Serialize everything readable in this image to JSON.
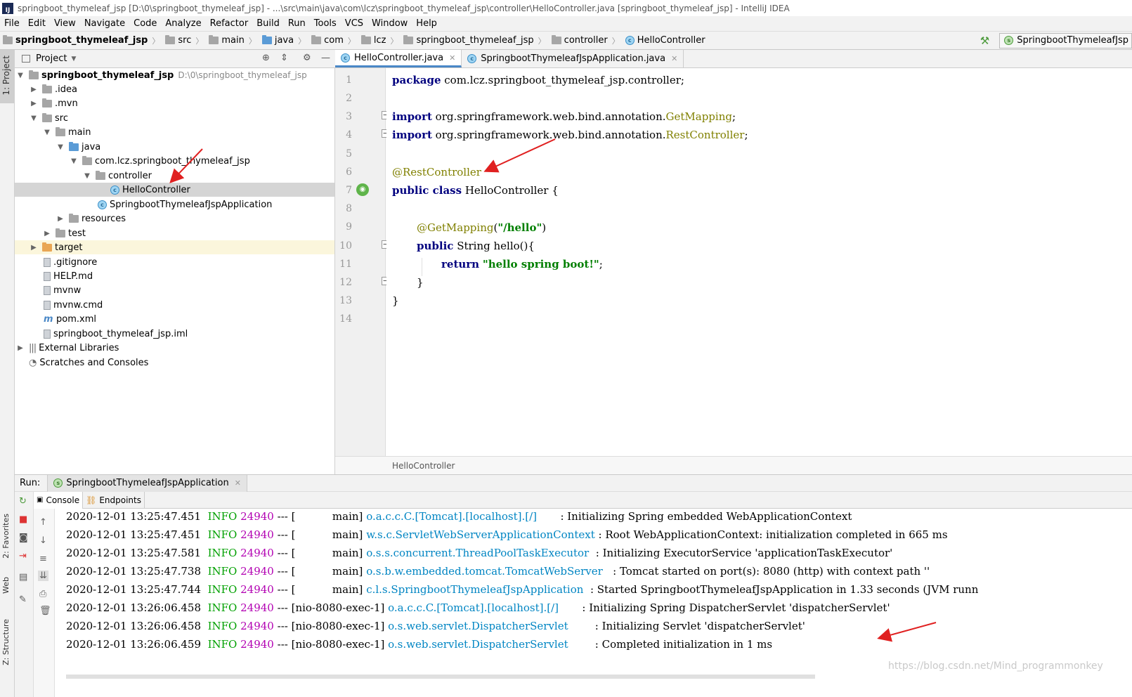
{
  "window": {
    "title": "springboot_thymeleaf_jsp [D:\\0\\springboot_thymeleaf_jsp] - ...\\src\\main\\java\\com\\lcz\\springboot_thymeleaf_jsp\\controller\\HelloController.java [springboot_thymeleaf_jsp] - IntelliJ IDEA",
    "logo": "IJ"
  },
  "menu": [
    "File",
    "Edit",
    "View",
    "Navigate",
    "Code",
    "Analyze",
    "Refactor",
    "Build",
    "Run",
    "Tools",
    "VCS",
    "Window",
    "Help"
  ],
  "nav": {
    "crumbs": [
      "springboot_thymeleaf_jsp",
      "src",
      "main",
      "java",
      "com",
      "lcz",
      "springboot_thymeleaf_jsp",
      "controller",
      "HelloController"
    ],
    "run_config": "SpringbootThymeleafJsp"
  },
  "left_strip": {
    "project": "1: Project",
    "favorites": "2: Favorites",
    "web": "Web",
    "structure": "Z: Structure"
  },
  "project_panel": {
    "title": "Project"
  },
  "tree": [
    {
      "label": "springboot_thymeleaf_jsp",
      "path": "D:\\0\\springboot_thymeleaf_jsp"
    },
    {
      "label": ".idea"
    },
    {
      "label": ".mvn"
    },
    {
      "label": "src"
    },
    {
      "label": "main"
    },
    {
      "label": "java"
    },
    {
      "label": "com.lcz.springboot_thymeleaf_jsp"
    },
    {
      "label": "controller"
    },
    {
      "label": "HelloController"
    },
    {
      "label": "SpringbootThymeleafJspApplication"
    },
    {
      "label": "resources"
    },
    {
      "label": "test"
    },
    {
      "label": "target"
    },
    {
      "label": ".gitignore"
    },
    {
      "label": "HELP.md"
    },
    {
      "label": "mvnw"
    },
    {
      "label": "mvnw.cmd"
    },
    {
      "label": "pom.xml"
    },
    {
      "label": "springboot_thymeleaf_jsp.iml"
    },
    {
      "label": "External Libraries"
    },
    {
      "label": "Scratches and Consoles"
    }
  ],
  "editor": {
    "tabs": [
      "HelloController.java",
      "SpringbootThymeleafJspApplication.java"
    ],
    "line_numbers": [
      "1",
      "2",
      "3",
      "4",
      "5",
      "6",
      "7",
      "8",
      "9",
      "10",
      "11",
      "12",
      "13",
      "14"
    ],
    "code": {
      "l1_kw": "package",
      "l1_rest": " com.lcz.springboot_thymeleaf_jsp.controller;",
      "l3_kw": "import",
      "l3_pkg": " org.springframework.web.bind.annotation.",
      "l3_cls": "GetMapping",
      "l3_end": ";",
      "l4_kw": "import",
      "l4_pkg": " org.springframework.web.bind.annotation.",
      "l4_cls": "RestController",
      "l4_end": ";",
      "l6_ann": "@RestController",
      "l7_kw": "public class",
      "l7_rest": " HelloController {",
      "l9_ann": "@GetMapping",
      "l9_open": "(",
      "l9_str": "\"/hello\"",
      "l9_close": ")",
      "l10_kw": "public",
      "l10_rest": " String hello(){",
      "l11_kw": "return",
      "l11_sp": " ",
      "l11_str": "\"hello spring boot!\"",
      "l11_end": ";",
      "l12": "}",
      "l13": "}"
    },
    "breadcrumb": "HelloController"
  },
  "run": {
    "label": "Run:",
    "config": "SpringbootThymeleafJspApplication",
    "tabs": [
      "Console",
      "Endpoints"
    ]
  },
  "log": [
    {
      "ts": "2020-12-01 13:25:47.451",
      "level": "INFO",
      "pid": "24940",
      "sep": "---",
      "thread": "[           main]",
      "logger": "o.a.c.c.C.[Tomcat].[localhost].[/]      ",
      "msg": ": Initializing Spring embedded WebApplicationContext"
    },
    {
      "ts": "2020-12-01 13:25:47.451",
      "level": "INFO",
      "pid": "24940",
      "sep": "---",
      "thread": "[           main]",
      "logger": "w.s.c.ServletWebServerApplicationContext",
      "msg": ": Root WebApplicationContext: initialization completed in 665 ms"
    },
    {
      "ts": "2020-12-01 13:25:47.581",
      "level": "INFO",
      "pid": "24940",
      "sep": "---",
      "thread": "[           main]",
      "logger": "o.s.s.concurrent.ThreadPoolTaskExecutor ",
      "msg": ": Initializing ExecutorService 'applicationTaskExecutor'"
    },
    {
      "ts": "2020-12-01 13:25:47.738",
      "level": "INFO",
      "pid": "24940",
      "sep": "---",
      "thread": "[           main]",
      "logger": "o.s.b.w.embedded.tomcat.TomcatWebServer  ",
      "msg": ": Tomcat started on port(s): 8080 (http) with context path ''"
    },
    {
      "ts": "2020-12-01 13:25:47.744",
      "level": "INFO",
      "pid": "24940",
      "sep": "---",
      "thread": "[           main]",
      "logger": "c.l.s.SpringbootThymeleafJspApplication ",
      "msg": ": Started SpringbootThymeleafJspApplication in 1.33 seconds (JVM runn"
    },
    {
      "ts": "2020-12-01 13:26:06.458",
      "level": "INFO",
      "pid": "24940",
      "sep": "---",
      "thread": "[nio-8080-exec-1]",
      "logger": "o.a.c.c.C.[Tomcat].[localhost].[/]      ",
      "msg": ": Initializing Spring DispatcherServlet 'dispatcherServlet'"
    },
    {
      "ts": "2020-12-01 13:26:06.458",
      "level": "INFO",
      "pid": "24940",
      "sep": "---",
      "thread": "[nio-8080-exec-1]",
      "logger": "o.s.web.servlet.DispatcherServlet       ",
      "msg": ": Initializing Servlet 'dispatcherServlet'"
    },
    {
      "ts": "2020-12-01 13:26:06.459",
      "level": "INFO",
      "pid": "24940",
      "sep": "---",
      "thread": "[nio-8080-exec-1]",
      "logger": "o.s.web.servlet.DispatcherServlet       ",
      "msg": ": Completed initialization in 1 ms"
    }
  ],
  "watermark": "https://blog.csdn.net/Mind_programmonkey",
  "colors": {
    "accent": "#4a88c7",
    "keyword": "#00007f",
    "annotation": "#808000",
    "string": "#007f00",
    "log_info": "#00a000",
    "log_pid": "#b200b2",
    "log_logger": "#0085c3",
    "annotation_arrow": "#e02020"
  }
}
